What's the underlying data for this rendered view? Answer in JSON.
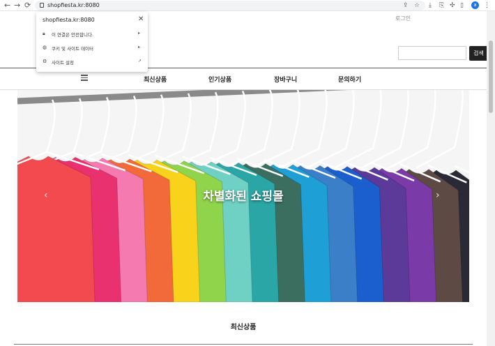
{
  "browser": {
    "url": "shopfiesta.kr:8080",
    "back_icon": "arrow-left-icon",
    "forward_icon": "arrow-right-icon",
    "reload_icon": "reload-icon",
    "profile_initial": "a"
  },
  "site_popup": {
    "host": "shopfiesta.kr:8080",
    "rows": [
      {
        "label": "이 연결은 안전합니다.",
        "icon": "lock-icon"
      },
      {
        "label": "쿠키 및 사이트 데이터",
        "icon": "cookie-icon"
      },
      {
        "label": "사이트 설정",
        "icon": "gear-icon"
      }
    ]
  },
  "header": {
    "login_label": "로그인",
    "search_placeholder": "",
    "search_button": "검색"
  },
  "nav": {
    "items": [
      "최신상품",
      "인기상품",
      "장바구니",
      "문의하기"
    ]
  },
  "hero": {
    "title": "차별화된 쇼핑몰",
    "shirt_colors": [
      "#f34a4f",
      "#e8316e",
      "#f47ab0",
      "#f36a3a",
      "#f9d21c",
      "#8fd44a",
      "#6fd0c4",
      "#2aa6a6",
      "#3b6e5e",
      "#1e9fd6",
      "#3b7fc9",
      "#1b5fcf",
      "#5b3a9a",
      "#7a3aa8",
      "#5e4a44",
      "#2a2a36"
    ]
  },
  "section": {
    "title": "최신상품"
  }
}
